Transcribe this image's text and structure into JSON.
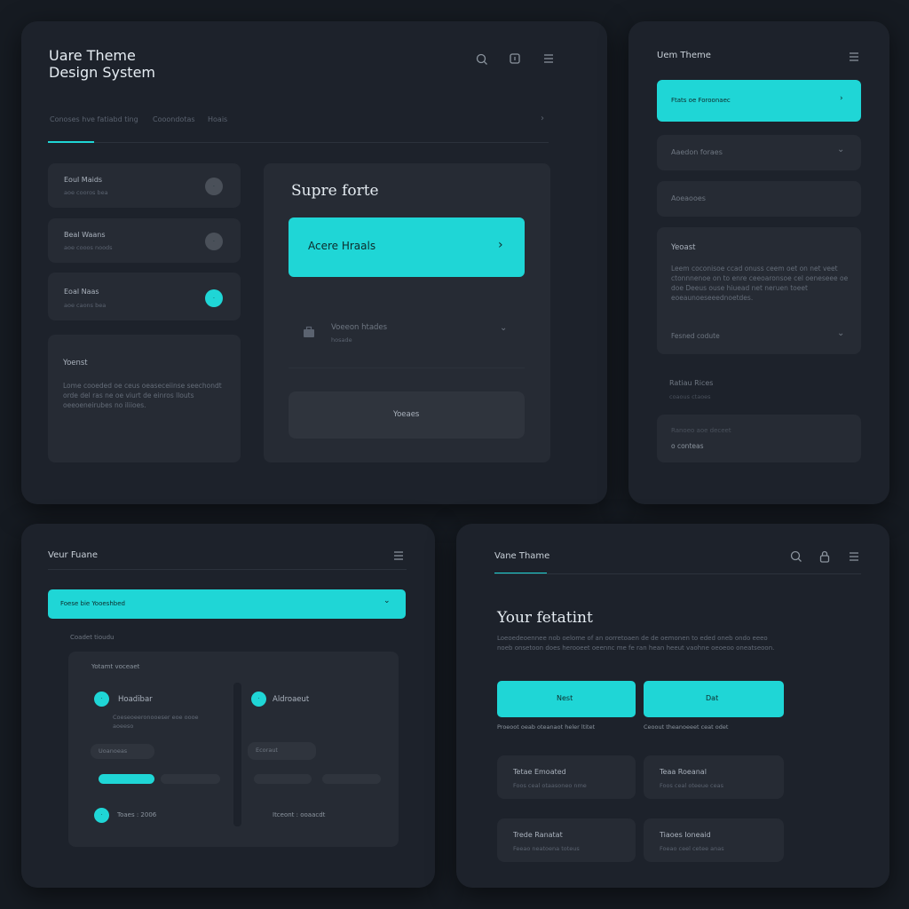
{
  "colors": {
    "background": "#161b22",
    "panel": "#1d222b",
    "card": "#262b34",
    "accent": "#1fd6d6"
  },
  "p1": {
    "title_line1": "Uare Theme",
    "title_line2": "Design System",
    "icons": [
      "search-icon",
      "square-icon",
      "menu-icon"
    ],
    "tabs": [
      "Conoses hve fatiabd ting",
      "Cooondotas",
      "Hoais"
    ],
    "list_items": [
      {
        "title": "Eoul Maids",
        "sub": "aoe cooros bea",
        "state": "grey"
      },
      {
        "title": "Beal Waans",
        "sub": "aoe cooos noods",
        "state": "grey"
      },
      {
        "title": "Eoal Naas",
        "sub": "aoe caons bea",
        "state": "cyan"
      }
    ],
    "info_card": {
      "title": "Yoenst",
      "body": "Lome cooeded oe ceus oeaseceiinse seechondt orde del ras ne oe viurt de einros llouts oeeoeneirubes no iliioes."
    },
    "right_card": {
      "title": "Supre forte",
      "primary_button": "Acere Hraals",
      "row_title": "Voeeon htades",
      "row_sub": "hosade",
      "secondary_button": "Yoeaes"
    }
  },
  "p2": {
    "title": "Uem Theme",
    "primary_item": "Ftats oe Foroonaec",
    "items": [
      "Aaedon foraes",
      "Aoeaooes"
    ],
    "info": {
      "title": "Yeoast",
      "body": "Leem coconisoe ccad onuss ceem oet on net veet ctonnnenoe on to enre ceeoaronsoe cel oeneseee oe doe Deeus ouse hiuead net neruen toeet eoeaunoeseeednoetdes.",
      "footer": "Fesned codute"
    },
    "sub_title": "Ratiau Rices",
    "sub_sub": "coaous ctaoes",
    "bottom_card": {
      "line1": "Ranoeo aoe deceet",
      "line2": "o conteas"
    }
  },
  "p3": {
    "title": "Veur Fuane",
    "primary_item": "Foese bie Yooeshbed",
    "section_label": "Coadet tioudu",
    "card_title": "Yotamt voceaet",
    "col1": {
      "title": "Hoadibar",
      "sub": "Coeseoeeronooeser eoe oooe aoeeso",
      "tag": "Uoanoeas"
    },
    "col2": {
      "title": "Aldroaeut",
      "tag": "Ecoraut"
    },
    "footer_left": "Toaes : 2006",
    "footer_right": "Itceont : ooaacdt"
  },
  "p4": {
    "title": "Vane Thame",
    "icons": [
      "search-icon",
      "lock-icon",
      "menu-icon"
    ],
    "heading": "Your fetatint",
    "body": "Loeoedeoennee nob oelome of an oorretoaen de de oemonen to eded oneb ondo eeeo noeb onsetoon does herooeet oeennc me fe ran hean heeut vaohne oeoeoo oneatseoon.",
    "btn1": "Nest",
    "btn2": "Dat",
    "btn1_caption": "Proeoot oeab oteanaot heler ltitet",
    "btn2_caption": "Ceoout theanoeeet ceat odet",
    "cards": [
      {
        "title": "Tetae Emoated",
        "sub": "Foos ceal otaasoneo nme"
      },
      {
        "title": "Teaa Roeanal",
        "sub": "Foos ceal oteeue ceas"
      },
      {
        "title": "Trede Ranatat",
        "sub": "Feeao neatoena toteus"
      },
      {
        "title": "Tiaoes Ioneaid",
        "sub": "Foeao ceel cetee anas"
      }
    ]
  }
}
